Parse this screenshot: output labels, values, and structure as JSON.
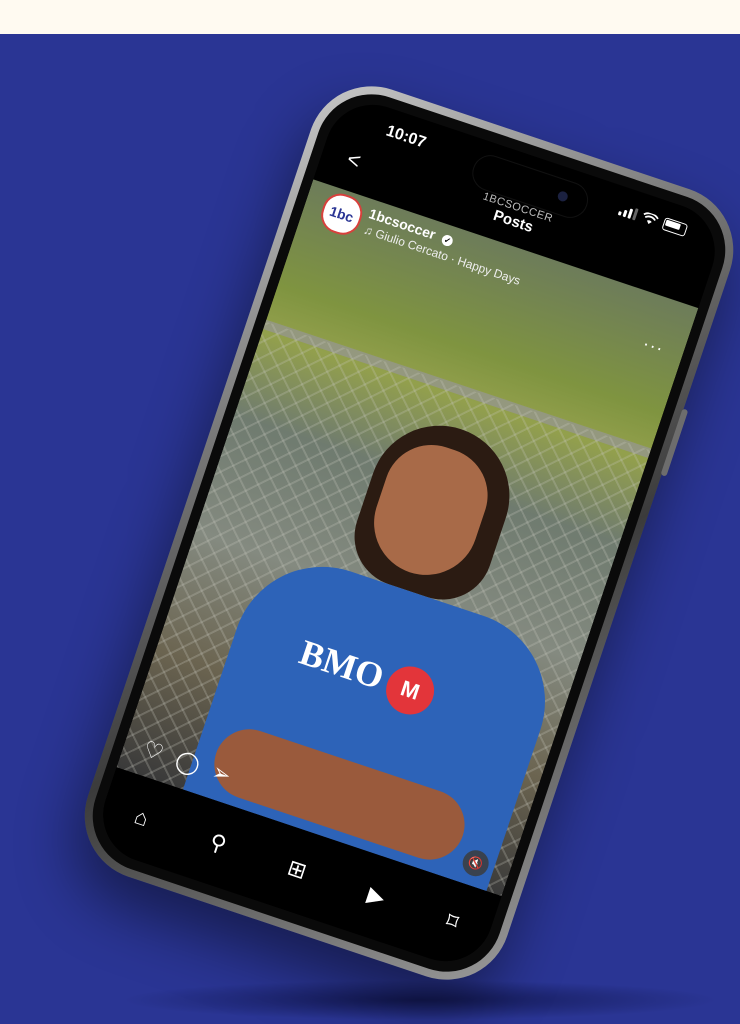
{
  "status_bar": {
    "time": "10:07"
  },
  "header": {
    "back_label": "<",
    "subtitle": "1BCSOCCER",
    "title": "Posts"
  },
  "post": {
    "username": "1bcsoccer",
    "verified_mark": "✓",
    "audio_label": "♫ Giulio Cercato · Happy Days",
    "more_label": "···",
    "shirt_text": "BMO",
    "mute_label": "🔇"
  },
  "actions": {
    "like_icon": "♡",
    "comment_icon": "◯",
    "share_icon": "➢",
    "save_icon": "⌑"
  },
  "bottom_nav": {
    "home_icon": "⌂",
    "search_icon": "⚲",
    "create_icon": "⊞",
    "reels_icon": "▶"
  },
  "colors": {
    "background": "#2a3594",
    "top_band": "#fffaf1",
    "accent_red": "#e3353a"
  }
}
